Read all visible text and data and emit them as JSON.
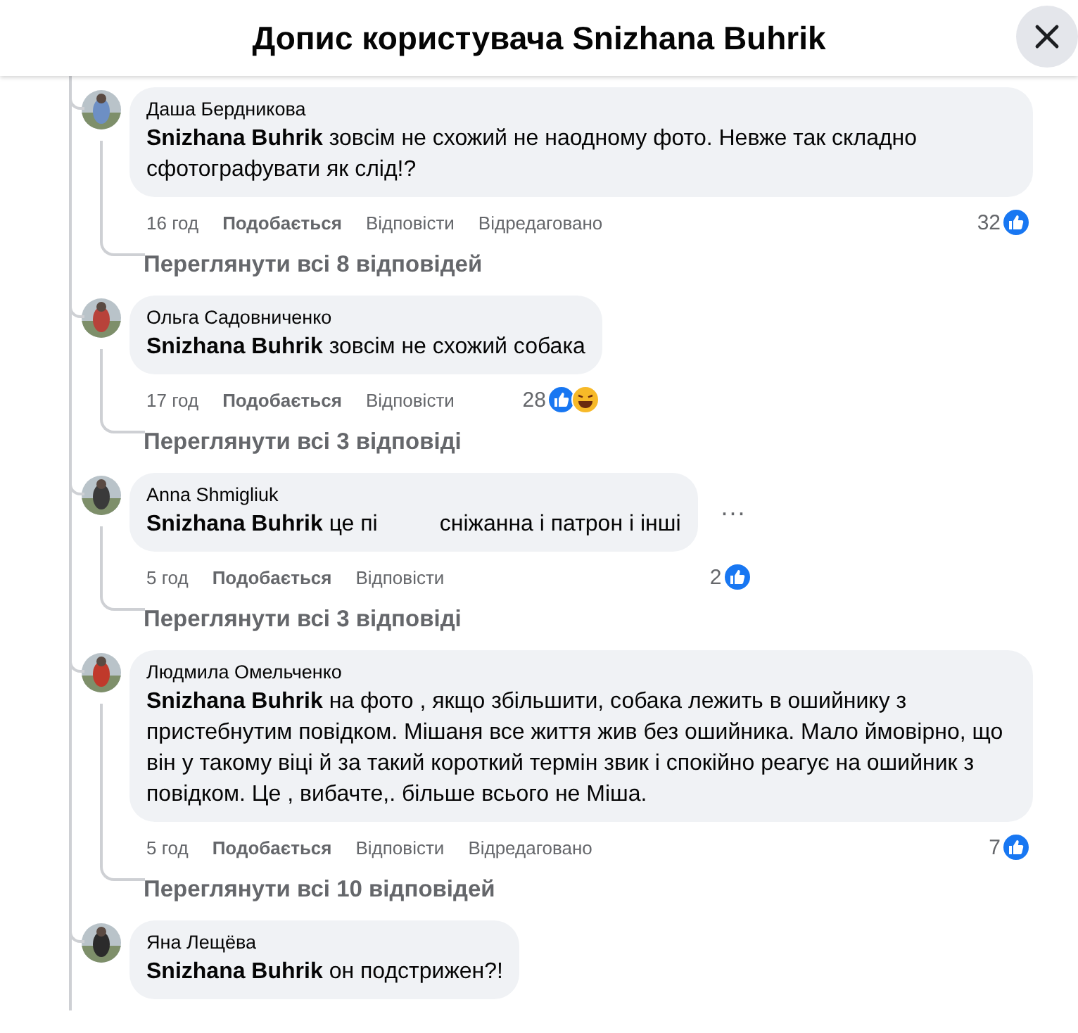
{
  "header": {
    "title": "Допис користувача Snizhana Buhrik"
  },
  "comments": [
    {
      "author": "Даша Бердникова",
      "mention": "Snizhana Buhrik",
      "text": [
        "зовсім не схожий не наодному фото. Невже так складно сфотографувати як слід!?"
      ],
      "actions": [
        {
          "label": "16 год",
          "kind": "time"
        },
        {
          "label": "Подобається",
          "kind": "like"
        },
        {
          "label": "Відповісти",
          "kind": "reply"
        },
        {
          "label": "Відредаговано",
          "kind": "edited"
        }
      ],
      "count": "32",
      "reactions": [
        {
          "kind": "like"
        }
      ],
      "replies": "Переглянути всі 8 відповідей"
    },
    {
      "author": "Ольга Садовниченко",
      "mention": "Snizhana Buhrik",
      "text": [
        "зовсім не схожий собака"
      ],
      "actions": [
        {
          "label": "17 год",
          "kind": "time"
        },
        {
          "label": "Подобається",
          "kind": "like"
        },
        {
          "label": "Відповісти",
          "kind": "reply"
        }
      ],
      "count": "28",
      "reactions": [
        {
          "kind": "like"
        },
        {
          "kind": "haha"
        }
      ],
      "replies": "Переглянути всі 3 відповіді"
    },
    {
      "author": "Anna Shmigliuk",
      "mention": "Snizhana Buhrik",
      "text": [
        "це пі",
        "сніжанна і патрон і інші"
      ],
      "more": "···",
      "actions": [
        {
          "label": "5 год",
          "kind": "time"
        },
        {
          "label": "Подобається",
          "kind": "like"
        },
        {
          "label": "Відповісти",
          "kind": "reply"
        }
      ],
      "count": "2",
      "reactions": [
        {
          "kind": "like"
        }
      ],
      "replies": "Переглянути всі 3 відповіді"
    },
    {
      "author": "Людмила Омельченко",
      "mention": "Snizhana Buhrik",
      "text": [
        "на фото , якщо збільшити, собака лежить в ошийнику з пристебнутим повідком. Мішаня все життя жив без ошийника. Мало ймовірно, що він у такому віці й за такий короткий термін звик і спокійно реагує на ошийник з повідком. Це , вибачте,. більше всього не Міша."
      ],
      "actions": [
        {
          "label": "5 год",
          "kind": "time"
        },
        {
          "label": "Подобається",
          "kind": "like"
        },
        {
          "label": "Відповісти",
          "kind": "reply"
        },
        {
          "label": "Відредаговано",
          "kind": "edited"
        }
      ],
      "count": "7",
      "reactions": [
        {
          "kind": "like"
        }
      ],
      "replies": "Переглянути всі 10 відповідей"
    },
    {
      "author": "Яна Лещёва",
      "mention": "Snizhana Buhrik",
      "text": [
        "он подстрижен?!"
      ]
    }
  ]
}
